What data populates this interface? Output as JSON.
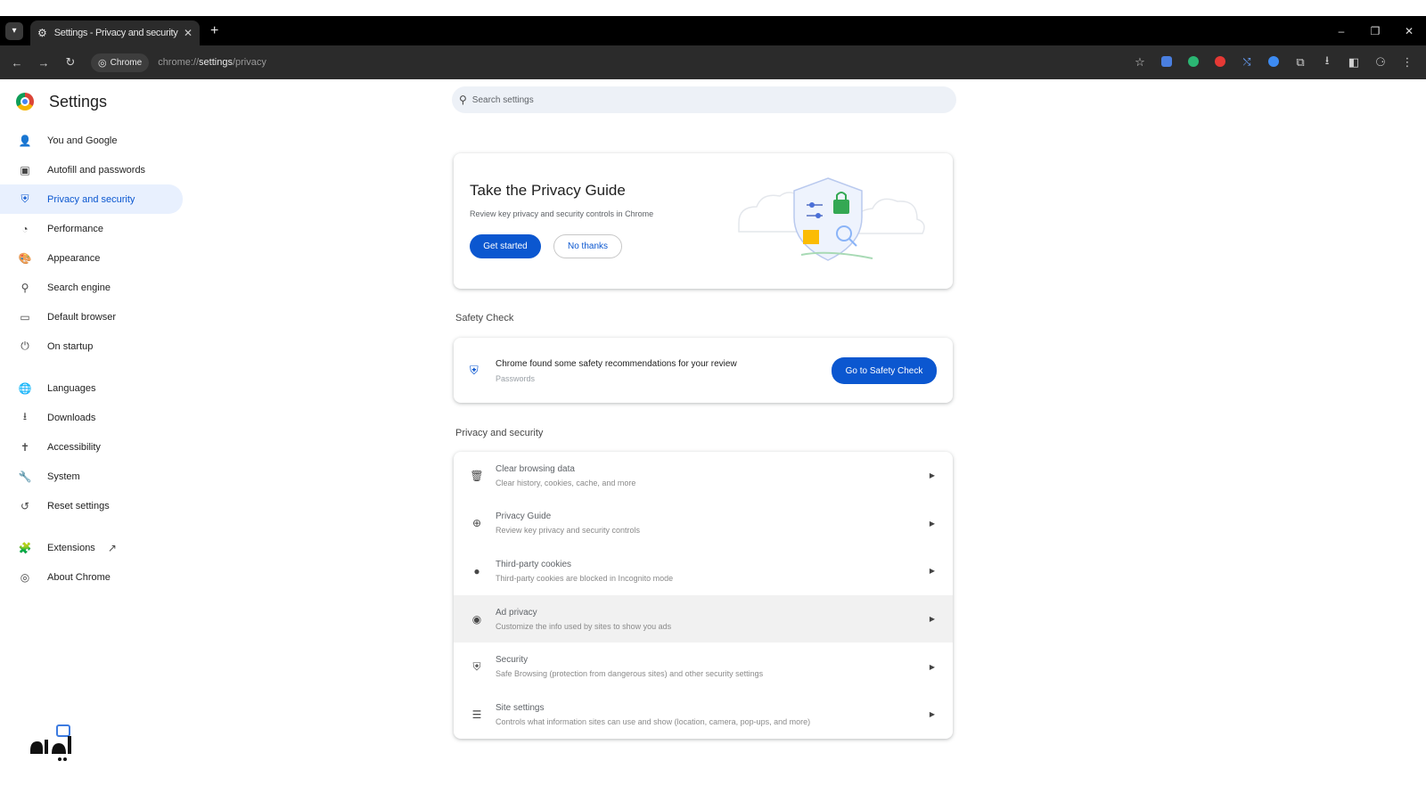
{
  "browser": {
    "tab_title": "Settings - Privacy and security",
    "tab_icon": "gear-icon",
    "tab_close": "✕",
    "new_tab": "+",
    "site_chip": "Chrome",
    "url_prefix": "chrome://",
    "url_host": "settings",
    "url_path": "/privacy",
    "window_controls": [
      "–",
      "❐",
      "✕"
    ]
  },
  "sidebar": {
    "title": "Settings",
    "items": [
      {
        "label": "You and Google",
        "icon": "person-icon",
        "glyph": "👤"
      },
      {
        "label": "Autofill and passwords",
        "icon": "clipboard-icon",
        "glyph": "▣"
      },
      {
        "label": "Privacy and security",
        "icon": "shield-icon",
        "glyph": "⛨",
        "active": true
      },
      {
        "label": "Performance",
        "icon": "speedometer-icon",
        "glyph": "◔"
      },
      {
        "label": "Appearance",
        "icon": "palette-icon",
        "glyph": "🎨"
      },
      {
        "label": "Search engine",
        "icon": "search-icon",
        "glyph": "⚲"
      },
      {
        "label": "Default browser",
        "icon": "browser-window-icon",
        "glyph": "▭"
      },
      {
        "label": "On startup",
        "icon": "power-icon",
        "glyph": "⏻"
      },
      {
        "label": "Languages",
        "icon": "globe-icon",
        "glyph": "🌐"
      },
      {
        "label": "Downloads",
        "icon": "download-icon",
        "glyph": "⭳"
      },
      {
        "label": "Accessibility",
        "icon": "accessibility-icon",
        "glyph": "✝"
      },
      {
        "label": "System",
        "icon": "wrench-icon",
        "glyph": "🔧"
      },
      {
        "label": "Reset settings",
        "icon": "reset-icon",
        "glyph": "↺"
      },
      {
        "label": "Extensions",
        "icon": "puzzle-icon",
        "glyph": "🧩"
      },
      {
        "label": "About Chrome",
        "icon": "chrome-icon",
        "glyph": "◎"
      }
    ]
  },
  "search": {
    "placeholder": "Search settings"
  },
  "privacy_guide": {
    "title": "Take the Privacy Guide",
    "description": "Review key privacy and security controls in Chrome",
    "primary_button": "Get started",
    "secondary_button": "No thanks"
  },
  "safety_check": {
    "section_title": "Safety Check",
    "message": "Chrome found some safety recommendations for your review",
    "sub": "Passwords",
    "button": "Go to Safety Check"
  },
  "privacy_section": {
    "section_title": "Privacy and security",
    "rows": [
      {
        "title": "Clear browsing data",
        "sub": "Clear history, cookies, cache, and more",
        "icon": "trash-icon",
        "glyph": "🗑"
      },
      {
        "title": "Privacy Guide",
        "sub": "Review key privacy and security controls",
        "icon": "compass-icon",
        "glyph": "⊕"
      },
      {
        "title": "Third-party cookies",
        "sub": "Third-party cookies are blocked in Incognito mode",
        "icon": "cookie-icon",
        "glyph": "●"
      },
      {
        "title": "Ad privacy",
        "sub": "Customize the info used by sites to show you ads",
        "icon": "ad-privacy-icon",
        "glyph": "◉",
        "highlight": true
      },
      {
        "title": "Security",
        "sub": "Safe Browsing (protection from dangerous sites) and other security settings",
        "icon": "security-shield-icon",
        "glyph": "⛨"
      },
      {
        "title": "Site settings",
        "sub": "Controls what information sites can use and show (location, camera, pop-ups, and more)",
        "icon": "sliders-icon",
        "glyph": "☰"
      }
    ]
  },
  "colors": {
    "accent": "#0b57d0",
    "active_nav_bg": "#e8f0fe",
    "tabstrip_bg": "#000000",
    "toolbar_bg": "#2b2b2b"
  }
}
